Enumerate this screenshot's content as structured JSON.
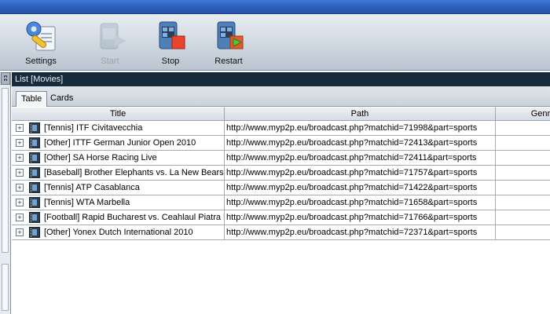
{
  "toolbar": {
    "settings_label": "Settings",
    "start_label": "Start",
    "stop_label": "Stop",
    "restart_label": "Restart"
  },
  "panel": {
    "header": "List [Movies]",
    "tabs": [
      {
        "label": "Table",
        "active": true
      },
      {
        "label": "Cards",
        "active": false
      }
    ]
  },
  "grid": {
    "columns": [
      "Title",
      "Path",
      "Genre"
    ],
    "rows": [
      {
        "title": "[Tennis] ITF Civitavecchia",
        "path": "http://www.myp2p.eu/broadcast.php?matchid=71998&part=sports"
      },
      {
        "title": "[Other] ITTF German Junior Open 2010",
        "path": "http://www.myp2p.eu/broadcast.php?matchid=72413&part=sports"
      },
      {
        "title": "[Other] SA Horse Racing Live",
        "path": "http://www.myp2p.eu/broadcast.php?matchid=72411&part=sports"
      },
      {
        "title": "[Baseball] Brother Elephants vs. La New Bears",
        "path": "http://www.myp2p.eu/broadcast.php?matchid=71757&part=sports"
      },
      {
        "title": "[Tennis] ATP Casablanca",
        "path": "http://www.myp2p.eu/broadcast.php?matchid=71422&part=sports"
      },
      {
        "title": "[Tennis] WTA Marbella",
        "path": "http://www.myp2p.eu/broadcast.php?matchid=71658&part=sports"
      },
      {
        "title": "[Football] Rapid Bucharest vs. Ceahlaul Piatra N",
        "path": "http://www.myp2p.eu/broadcast.php?matchid=71766&part=sports"
      },
      {
        "title": "[Other] Yonex Dutch International 2010",
        "path": "http://www.myp2p.eu/broadcast.php?matchid=72371&part=sports"
      }
    ]
  }
}
